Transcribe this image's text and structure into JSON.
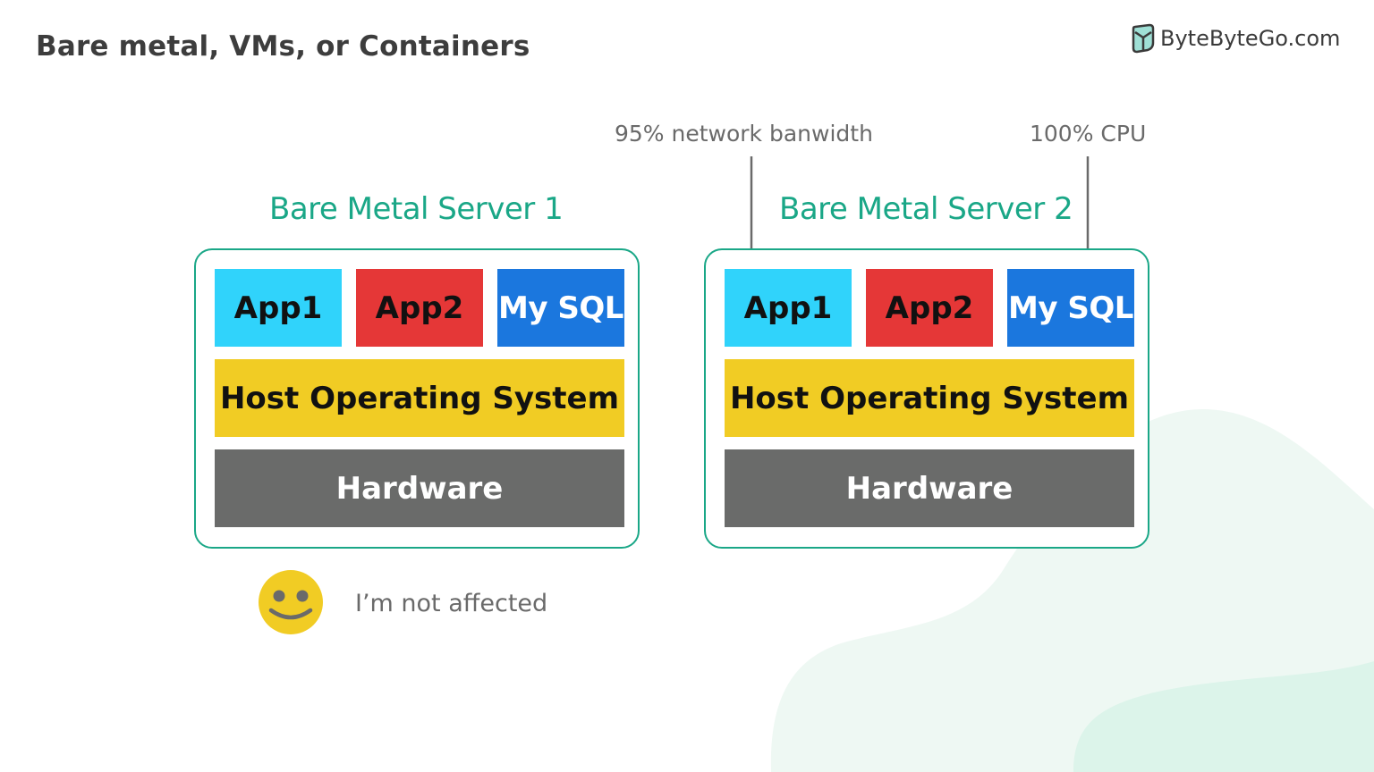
{
  "title": "Bare metal, VMs, or Containers",
  "logo": {
    "icon": "bytebytego-logo-icon",
    "text": "ByteByteGo.com"
  },
  "annotations": {
    "network": "95% network banwidth",
    "cpu": "100% CPU"
  },
  "servers": [
    {
      "title": "Bare Metal Server 1",
      "apps": [
        "App1",
        "App2",
        "My SQL"
      ],
      "os": "Host Operating System",
      "hardware": "Hardware"
    },
    {
      "title": "Bare Metal Server 2",
      "apps": [
        "App1",
        "App2",
        "My SQL"
      ],
      "os": "Host Operating System",
      "hardware": "Hardware"
    }
  ],
  "status": {
    "icon": "smiley-face-icon",
    "text": "I’m not affected"
  },
  "colors": {
    "accent": "#1aa787",
    "app1": "#30d3fb",
    "app2": "#e53737",
    "mysql": "#1b77de",
    "os": "#f1cc24",
    "hardware": "#6a6b6a",
    "smiley": "#f1cc24"
  }
}
